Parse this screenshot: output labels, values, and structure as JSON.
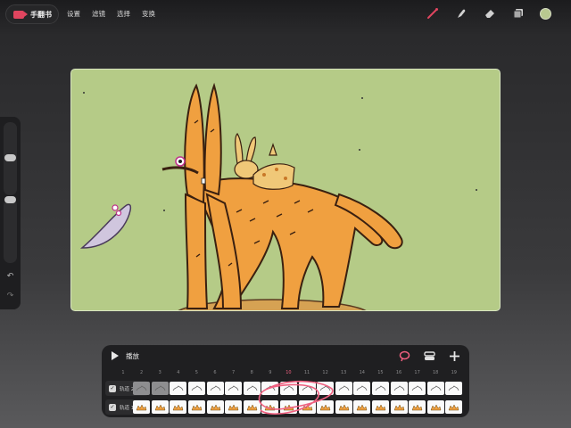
{
  "app": {
    "name": "手翻书",
    "menu": [
      "设置",
      "滤镜",
      "选择",
      "变换"
    ]
  },
  "tools": [
    "brush-icon",
    "smudge-icon",
    "eraser-icon",
    "layers-icon",
    "color-swatch"
  ],
  "colors": {
    "brand": "#e0455f",
    "brush_active": "#e0455f",
    "canvas_bg": "#b5cb87",
    "current_color": "#b8c890",
    "orange_fill": "#f0a040",
    "lasso": "#f06080"
  },
  "timeline": {
    "play_label": "播放",
    "frame_numbers": [
      "1",
      "2",
      "3",
      "4",
      "5",
      "6",
      "7",
      "8",
      "9",
      "10",
      "11",
      "12",
      "13",
      "14",
      "15",
      "16",
      "17",
      "18",
      "19",
      "20"
    ],
    "tracks": [
      {
        "label": "轨道 2",
        "checked": true
      },
      {
        "label": "轨道 1",
        "checked": true
      }
    ],
    "icons": [
      "lasso-icon",
      "track-settings-icon",
      "add-icon"
    ]
  },
  "sidebar": {
    "undo": "undo-icon",
    "redo": "redo-icon"
  }
}
